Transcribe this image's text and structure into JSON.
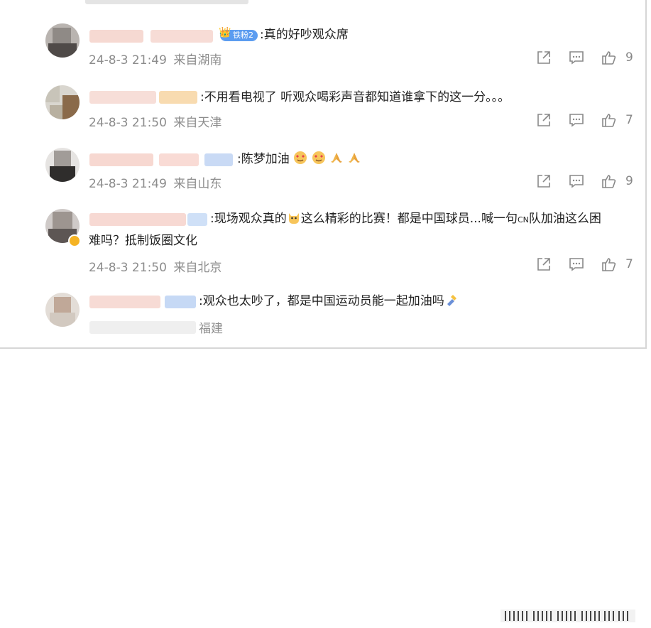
{
  "colors": {
    "meta_gray": "#8c8c8c",
    "icon_gray": "#888888",
    "badge_blue": "#5b9cf0"
  },
  "icons": {
    "share": "share-icon",
    "comment": "comment-icon",
    "like": "thumbs-up-icon"
  },
  "comments": [
    {
      "text": ":真的好吵观众席",
      "badge": "铁粉2",
      "time": "24-8-3 21:49",
      "location": "来自湖南",
      "likes": "9"
    },
    {
      "text": ":不用看电视了 听观众喝彩声音都知道谁拿下的这一分。。。",
      "time": "24-8-3 21:50",
      "location": "来自天津",
      "likes": "7"
    },
    {
      "text": ":陈梦加油",
      "time": "24-8-3 21:49",
      "location": "来自山东",
      "likes": "9"
    },
    {
      "text_line1_a": ":现场观众真的",
      "text_line1_b": "这么精彩的比赛！都是中国球员...喊一句",
      "text_line1_cn": "CN",
      "text_line1_c": "队加油这么困",
      "text_line2": "难吗？抵制饭圈文化",
      "time": "24-8-3 21:50",
      "location": "来自北京",
      "likes": "7"
    },
    {
      "text": ":观众也太吵了，都是中国运动员能一起加油吗",
      "location": "福建"
    }
  ]
}
